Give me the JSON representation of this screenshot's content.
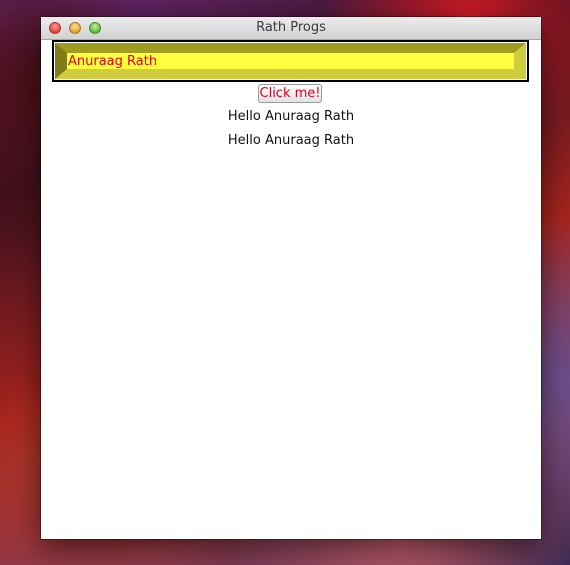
{
  "window": {
    "title": "Rath Progs"
  },
  "text_field": {
    "value": "Anuraag Rath"
  },
  "button": {
    "label": "Click me!"
  },
  "output_lines": [
    "Hello Anuraag Rath",
    "Hello Anuraag Rath"
  ],
  "colors": {
    "field_background": "#ffff3f",
    "field_text": "#e0001f",
    "button_text": "#e0001f"
  }
}
